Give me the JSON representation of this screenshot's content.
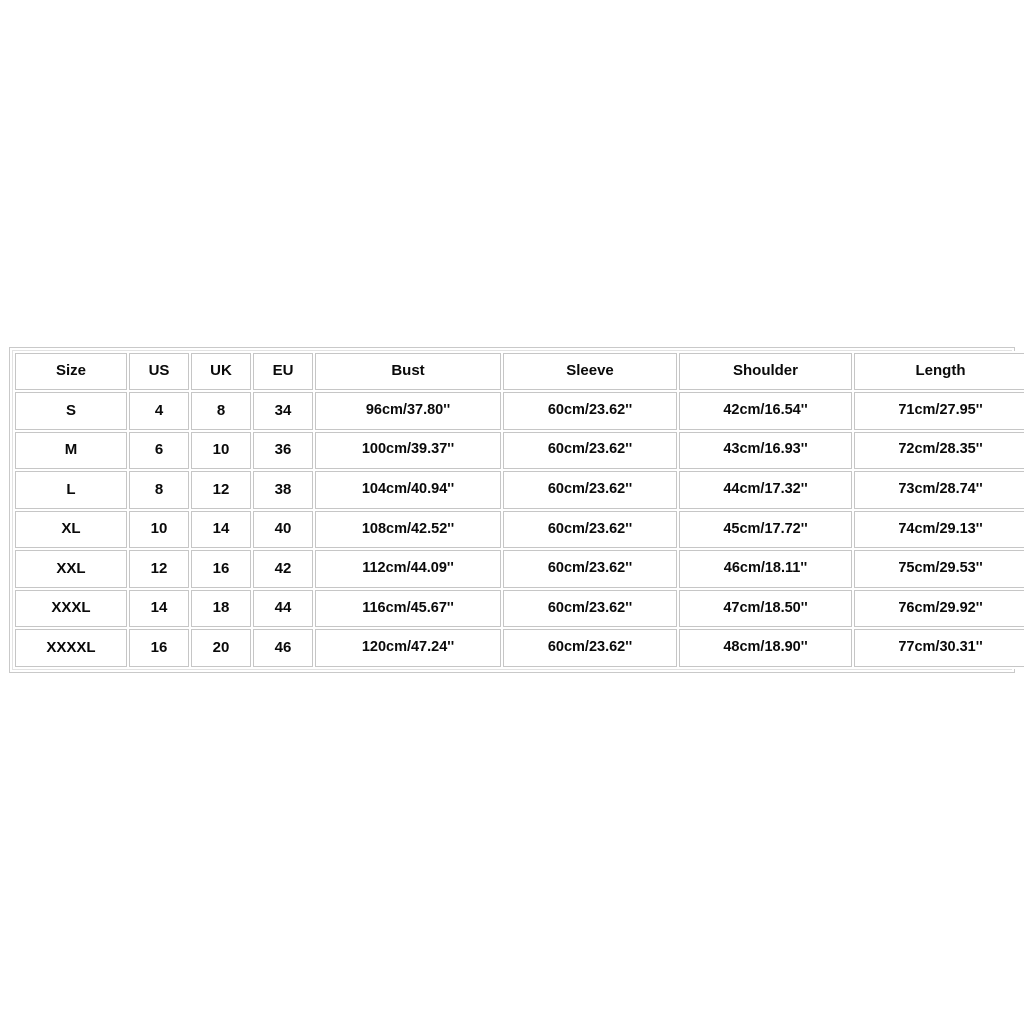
{
  "chart_data": {
    "type": "table",
    "title": "",
    "columns": [
      "Size",
      "US",
      "UK",
      "EU",
      "Bust",
      "Sleeve",
      "Shoulder",
      "Length"
    ],
    "rows": [
      [
        "S",
        "4",
        "8",
        "34",
        "96cm/37.80''",
        "60cm/23.62''",
        "42cm/16.54''",
        "71cm/27.95''"
      ],
      [
        "M",
        "6",
        "10",
        "36",
        "100cm/39.37''",
        "60cm/23.62''",
        "43cm/16.93''",
        "72cm/28.35''"
      ],
      [
        "L",
        "8",
        "12",
        "38",
        "104cm/40.94''",
        "60cm/23.62''",
        "44cm/17.32''",
        "73cm/28.74''"
      ],
      [
        "XL",
        "10",
        "14",
        "40",
        "108cm/42.52''",
        "60cm/23.62''",
        "45cm/17.72''",
        "74cm/29.13''"
      ],
      [
        "XXL",
        "12",
        "16",
        "42",
        "112cm/44.09''",
        "60cm/23.62''",
        "46cm/18.11''",
        "75cm/29.53''"
      ],
      [
        "XXXL",
        "14",
        "18",
        "44",
        "116cm/45.67''",
        "60cm/23.62''",
        "47cm/18.50''",
        "76cm/29.92''"
      ],
      [
        "XXXXL",
        "16",
        "20",
        "46",
        "120cm/47.24''",
        "60cm/23.62''",
        "48cm/18.90''",
        "77cm/30.31''"
      ]
    ]
  },
  "size_chart": {
    "headers": {
      "size": "Size",
      "us": "US",
      "uk": "UK",
      "eu": "EU",
      "bust": "Bust",
      "sleeve": "Sleeve",
      "shoulder": "Shoulder",
      "length": "Length"
    },
    "rows": [
      {
        "size": "S",
        "us": "4",
        "uk": "8",
        "eu": "34",
        "bust": "96cm/37.80''",
        "sleeve": "60cm/23.62''",
        "shoulder": "42cm/16.54''",
        "length": "71cm/27.95''"
      },
      {
        "size": "M",
        "us": "6",
        "uk": "10",
        "eu": "36",
        "bust": "100cm/39.37''",
        "sleeve": "60cm/23.62''",
        "shoulder": "43cm/16.93''",
        "length": "72cm/28.35''"
      },
      {
        "size": "L",
        "us": "8",
        "uk": "12",
        "eu": "38",
        "bust": "104cm/40.94''",
        "sleeve": "60cm/23.62''",
        "shoulder": "44cm/17.32''",
        "length": "73cm/28.74''"
      },
      {
        "size": "XL",
        "us": "10",
        "uk": "14",
        "eu": "40",
        "bust": "108cm/42.52''",
        "sleeve": "60cm/23.62''",
        "shoulder": "45cm/17.72''",
        "length": "74cm/29.13''"
      },
      {
        "size": "XXL",
        "us": "12",
        "uk": "16",
        "eu": "42",
        "bust": "112cm/44.09''",
        "sleeve": "60cm/23.62''",
        "shoulder": "46cm/18.11''",
        "length": "75cm/29.53''"
      },
      {
        "size": "XXXL",
        "us": "14",
        "uk": "18",
        "eu": "44",
        "bust": "116cm/45.67''",
        "sleeve": "60cm/23.62''",
        "shoulder": "47cm/18.50''",
        "length": "76cm/29.92''"
      },
      {
        "size": "XXXXL",
        "us": "16",
        "uk": "20",
        "eu": "46",
        "bust": "120cm/47.24''",
        "sleeve": "60cm/23.62''",
        "shoulder": "48cm/18.90''",
        "length": "77cm/30.31''"
      }
    ]
  },
  "colors": {
    "background": "#ffffff",
    "cell_background": "#ffffff",
    "cell_border": "#c6c6c6",
    "frame_border": "#c9c9c9",
    "text": "#0a0a0a"
  }
}
